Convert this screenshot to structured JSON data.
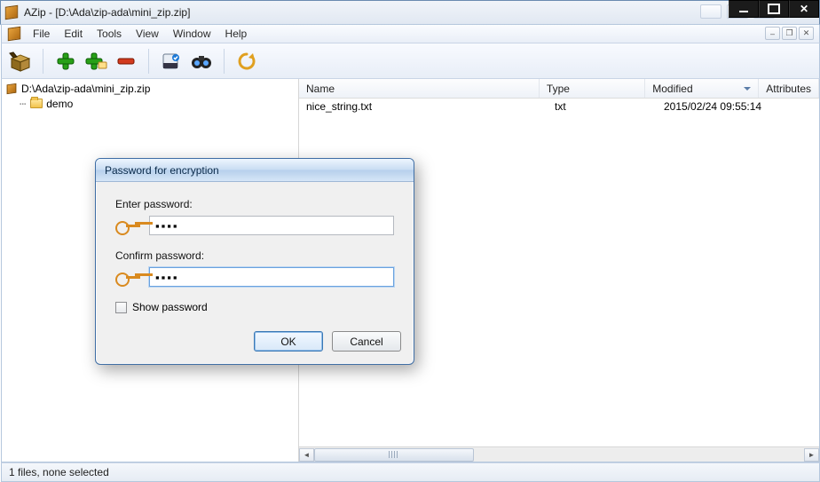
{
  "window": {
    "title": "AZip - [D:\\Ada\\zip-ada\\mini_zip.zip]"
  },
  "menu": {
    "items": [
      "File",
      "Edit",
      "Tools",
      "View",
      "Window",
      "Help"
    ]
  },
  "tree": {
    "root": "D:\\Ada\\zip-ada\\mini_zip.zip",
    "child": "demo"
  },
  "grid": {
    "columns": {
      "name": "Name",
      "type": "Type",
      "modified": "Modified",
      "attributes": "Attributes"
    },
    "rows": [
      {
        "name": "nice_string.txt",
        "type": "txt",
        "modified": "2015/02/24  09:55:14"
      }
    ]
  },
  "status": {
    "text": "1 files, none selected"
  },
  "dialog": {
    "title": "Password for encryption",
    "enter_label": "Enter password:",
    "confirm_label": "Confirm password:",
    "enter_value": "▪▪▪▪",
    "confirm_value": "▪▪▪▪",
    "show_label": "Show password",
    "ok": "OK",
    "cancel": "Cancel"
  }
}
